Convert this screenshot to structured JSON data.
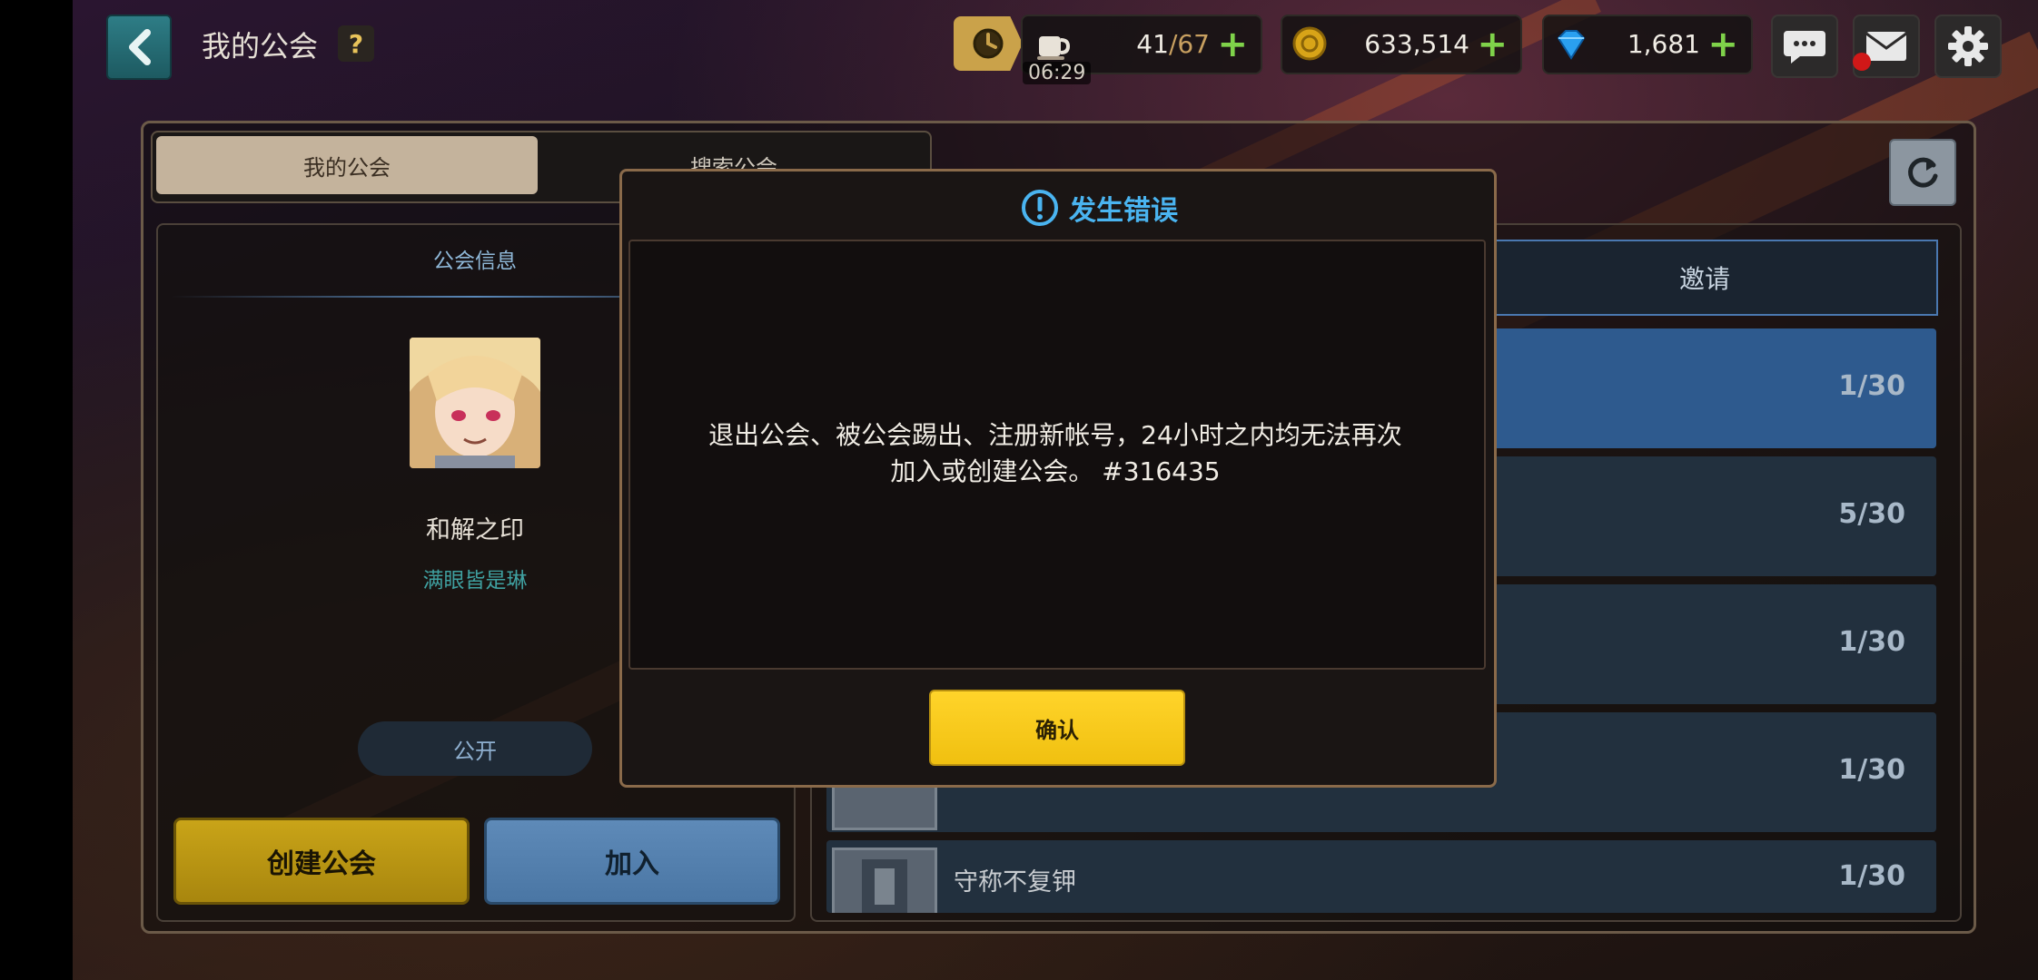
{
  "header": {
    "title": "我的公会",
    "help_label": "?"
  },
  "resources": {
    "stamina_current": "41",
    "stamina_max": "/67",
    "stamina_timer": "06:29",
    "gold": "633,514",
    "gems": "1,681"
  },
  "tabs": {
    "my_guild": "我的公会",
    "search_guild": "搜索公会"
  },
  "guild_info": {
    "section_label": "公会信息",
    "name": "和解之印",
    "leader": "满眼皆是琳",
    "visibility": "公开",
    "create_button": "创建公会",
    "join_button": "加入"
  },
  "guild_list": {
    "invite_tab": "邀请",
    "rows": [
      {
        "name": "",
        "count": "1/30"
      },
      {
        "name": "",
        "count": "5/30"
      },
      {
        "name": "",
        "count": "1/30"
      },
      {
        "name": "",
        "count": "1/30"
      },
      {
        "name": "守称不复钾",
        "count": "1/30"
      }
    ]
  },
  "dialog": {
    "title": "发生错误",
    "message_line1": "退出公会、被公会踢出、注册新帐号，24小时之内均无法再次",
    "message_line2": "加入或创建公会。 #316435",
    "confirm": "确认"
  },
  "colors": {
    "accent_blue": "#4ab4f0",
    "confirm_yellow": "#ffd42a",
    "create_gold": "#c9a418",
    "join_blue": "#5e8ab8",
    "selected_row": "#2e5a8e"
  }
}
